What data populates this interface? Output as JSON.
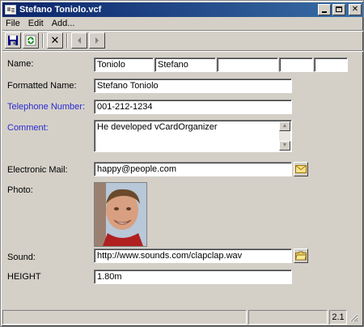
{
  "window": {
    "title": "Stefano Toniolo.vcf"
  },
  "menu": {
    "file": "File",
    "edit": "Edit",
    "add": "Add..."
  },
  "fields": {
    "name": {
      "label": "Name:",
      "values": [
        "Toniolo",
        "Stefano",
        "",
        "",
        ""
      ]
    },
    "formatted_name": {
      "label": "Formatted Name:",
      "value": "Stefano Toniolo"
    },
    "telephone": {
      "label": "Telephone Number:",
      "value": "001-212-1234"
    },
    "comment": {
      "label": "Comment:",
      "value": "He developed vCardOrganizer"
    },
    "email": {
      "label": "Electronic Mail:",
      "value": "happy@people.com"
    },
    "photo": {
      "label": "Photo:"
    },
    "sound": {
      "label": "Sound:",
      "value": "http://www.sounds.com/clapclap.wav"
    },
    "height": {
      "label": "HEIGHT",
      "value": "1.80m"
    }
  },
  "status": {
    "right": "2.1"
  },
  "colors": {
    "link_label": "#2a2ad0",
    "titlebar": "#0a246a"
  }
}
